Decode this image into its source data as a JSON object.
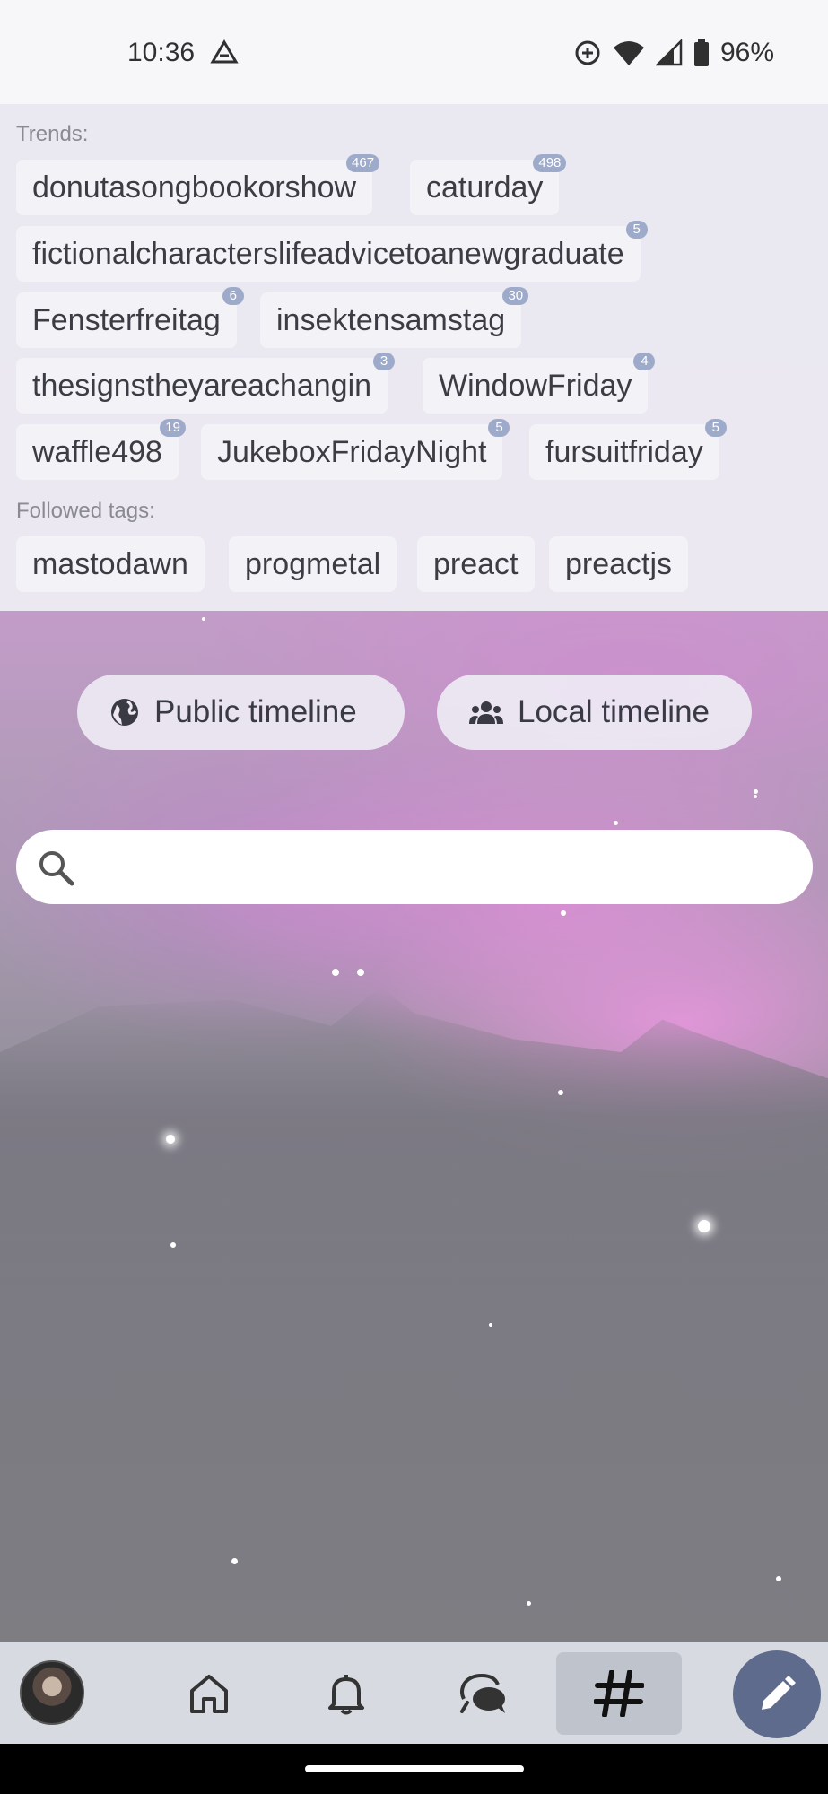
{
  "status_bar": {
    "time": "10:36",
    "battery": "96%",
    "icons": [
      "drive-icon",
      "data-saver-icon",
      "wifi-icon",
      "signal-icon",
      "battery-icon"
    ]
  },
  "trends": {
    "label": "Trends:",
    "tags": [
      {
        "name": "donutasongbookorshow",
        "count": "467"
      },
      {
        "name": "caturday",
        "count": "498"
      },
      {
        "name": "fictionalcharacterslifeadvicetoanewgraduate",
        "count": "5"
      },
      {
        "name": "Fensterfreitag",
        "count": "6"
      },
      {
        "name": "insektensamstag",
        "count": "30"
      },
      {
        "name": "thesignstheyareachangin",
        "count": "3"
      },
      {
        "name": "WindowFriday",
        "count": "4"
      },
      {
        "name": "waffle498",
        "count": "19"
      },
      {
        "name": "JukeboxFridayNight",
        "count": "5"
      },
      {
        "name": "fursuitfriday",
        "count": "5"
      }
    ]
  },
  "followed": {
    "label": "Followed tags:",
    "tags": [
      "mastodawn",
      "progmetal",
      "preact",
      "preactjs"
    ]
  },
  "timelines": {
    "public_label": "Public timeline",
    "local_label": "Local timeline"
  },
  "search": {
    "value": "",
    "placeholder": ""
  },
  "bottom_nav": {
    "items": [
      "avatar",
      "home-icon",
      "bell-icon",
      "chat-icon",
      "hashtag-icon"
    ],
    "active": "hashtag-icon",
    "compose": "pencil-icon"
  },
  "colors": {
    "panel": "#ECEBF3",
    "badge": "#9EAAC9",
    "fab": "#5E6B8C",
    "nav_bar": "#D7DAE0"
  }
}
